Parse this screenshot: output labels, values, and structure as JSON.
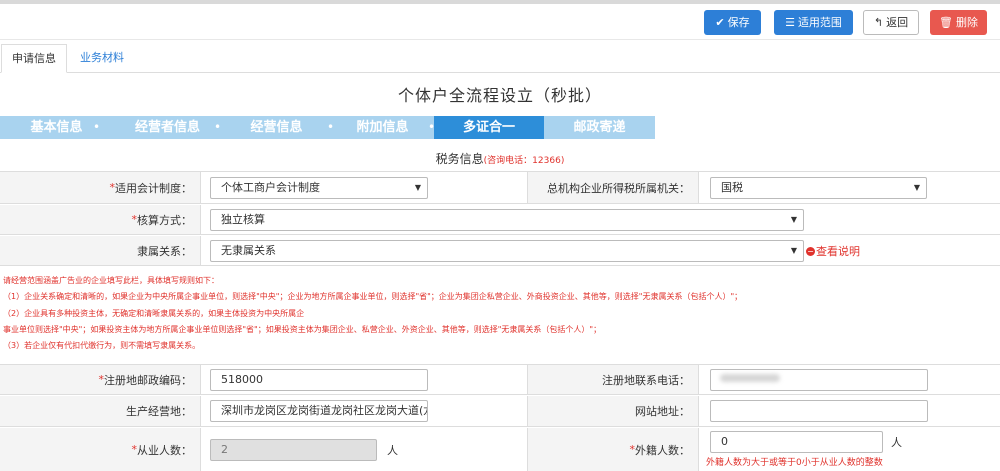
{
  "toolbar": {
    "save_label": "保存",
    "scope_label": "适用范围",
    "back_label": "返回",
    "delete_label": "删除"
  },
  "tabs": [
    {
      "label": "申请信息",
      "active": true
    },
    {
      "label": "业务材料",
      "active": false
    }
  ],
  "page_title": "个体户全流程设立（秒批）",
  "steps": [
    {
      "label": "基本信息",
      "active": false
    },
    {
      "label": "经营者信息",
      "active": false
    },
    {
      "label": "经营信息",
      "active": false
    },
    {
      "label": "附加信息",
      "active": false
    },
    {
      "label": "多证合一",
      "active": true
    },
    {
      "label": "邮政寄递",
      "active": false
    }
  ],
  "section": {
    "title": "税务信息",
    "hotline": "(咨询电话：12366)"
  },
  "form": {
    "accounting_system": {
      "label": "适用会计制度：",
      "required": true,
      "value": "个体工商户会计制度"
    },
    "tax_authority": {
      "label": "总机构企业所得税所属机关：",
      "required": false,
      "value": "国税"
    },
    "accounting_method": {
      "label": "核算方式：",
      "required": true,
      "value": "独立核算"
    },
    "affiliation": {
      "label": "隶属关系：",
      "required": false,
      "value": "无隶属关系"
    },
    "affiliation_help": "查看说明",
    "postal_code": {
      "label": "注册地邮政编码：",
      "required": true,
      "value": "518000"
    },
    "phone": {
      "label": "注册地联系电话：",
      "required": false,
      "value": ""
    },
    "address": {
      "label": "生产经营地：",
      "required": false,
      "value": "深圳市龙岗区龙岗街道龙岗社区龙岗大道(龙岗"
    },
    "website": {
      "label": "网站地址：",
      "required": false,
      "value": ""
    },
    "employees": {
      "label": "从业人数：",
      "required": true,
      "value": "2",
      "unit": "人"
    },
    "foreign_employees": {
      "label": "外籍人数：",
      "required": true,
      "value": "0",
      "unit": "人",
      "error": "外籍人数为大于或等于0小于从业人数的整数"
    }
  },
  "notes": [
    "请经营范围涵盖广告业的企业填写此栏，具体填写规则如下：",
    "（1）企业关系确定和清晰的，如果企业为中央所属企事业单位，则选择\"中央\"；企业为地方所属企事业单位，则选择\"省\"；企业为集团企私营企业、外商投资企业、其他等，则选择\"无隶属关系（包括个人）\"；",
    "（2）企业具有多种投资主体，无确定和清晰隶属关系的，如果主体投资为中央所属企",
    "事业单位则选择\"中央\"；如果投资主体为地方所属企事业单位则选择\"省\"；如果投资主体为集团企业、私营企业、外资企业、其他等，则选择\"无隶属关系（包括个人）\"；",
    "（3）若企业仅有代扣代缴行为，则不需填写隶属关系。"
  ],
  "colors": {
    "primary": "#2d7fd7",
    "danger": "#e8584f",
    "step_active": "#2d8ed9",
    "step_inactive": "#a9d3ef",
    "required": "#e0322c"
  }
}
